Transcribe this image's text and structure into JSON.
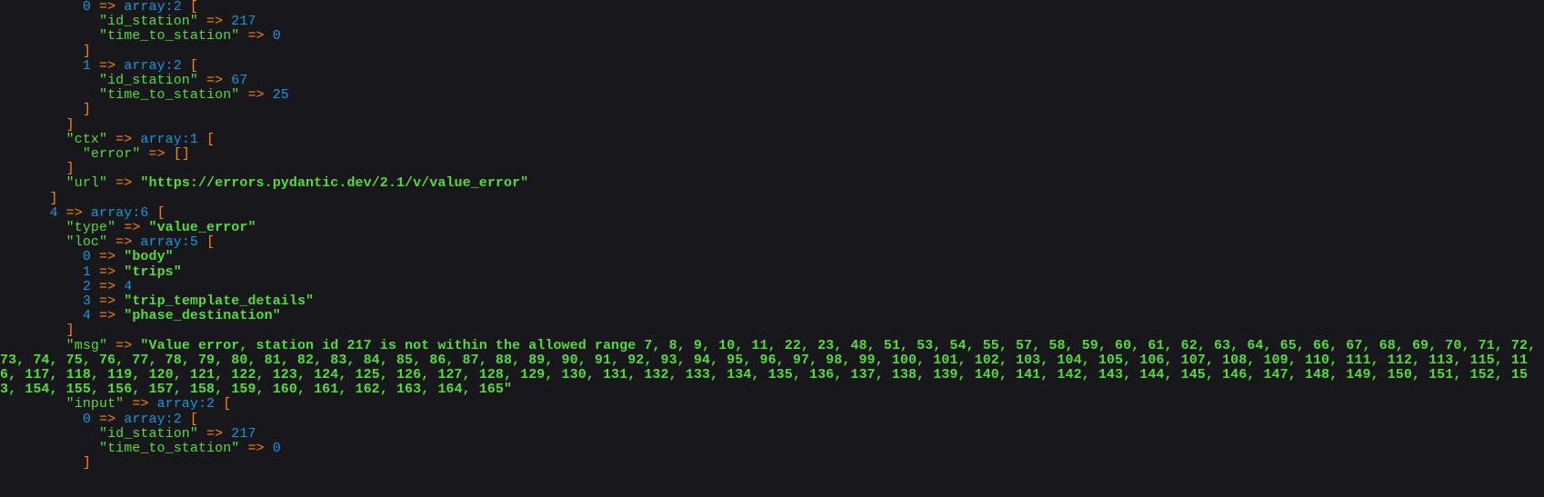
{
  "colors": {
    "background": "#18171B",
    "key": "#56DB3A",
    "string": "#56DB3A",
    "number": "#1299DA",
    "note": "#1299DA",
    "arrow": "#FF8400",
    "bracket": "#FF8400"
  },
  "lines": [
    {
      "indent": 10,
      "parts": [
        {
          "t": "0",
          "c": "i"
        },
        {
          "t": " => ",
          "c": "a"
        },
        {
          "t": "array:2",
          "c": "note"
        },
        {
          "t": " [",
          "c": "b"
        }
      ]
    },
    {
      "indent": 12,
      "parts": [
        {
          "t": "\"id_station\"",
          "c": "k"
        },
        {
          "t": " => ",
          "c": "a"
        },
        {
          "t": "217",
          "c": "n"
        }
      ]
    },
    {
      "indent": 12,
      "parts": [
        {
          "t": "\"time_to_station\"",
          "c": "k"
        },
        {
          "t": " => ",
          "c": "a"
        },
        {
          "t": "0",
          "c": "n"
        }
      ]
    },
    {
      "indent": 10,
      "parts": [
        {
          "t": "]",
          "c": "b"
        }
      ]
    },
    {
      "indent": 10,
      "parts": [
        {
          "t": "1",
          "c": "i"
        },
        {
          "t": " => ",
          "c": "a"
        },
        {
          "t": "array:2",
          "c": "note"
        },
        {
          "t": " [",
          "c": "b"
        }
      ]
    },
    {
      "indent": 12,
      "parts": [
        {
          "t": "\"id_station\"",
          "c": "k"
        },
        {
          "t": " => ",
          "c": "a"
        },
        {
          "t": "67",
          "c": "n"
        }
      ]
    },
    {
      "indent": 12,
      "parts": [
        {
          "t": "\"time_to_station\"",
          "c": "k"
        },
        {
          "t": " => ",
          "c": "a"
        },
        {
          "t": "25",
          "c": "n"
        }
      ]
    },
    {
      "indent": 10,
      "parts": [
        {
          "t": "]",
          "c": "b"
        }
      ]
    },
    {
      "indent": 8,
      "parts": [
        {
          "t": "]",
          "c": "b"
        }
      ]
    },
    {
      "indent": 8,
      "parts": [
        {
          "t": "\"ctx\"",
          "c": "k"
        },
        {
          "t": " => ",
          "c": "a"
        },
        {
          "t": "array:1",
          "c": "note"
        },
        {
          "t": " [",
          "c": "b"
        }
      ]
    },
    {
      "indent": 10,
      "parts": [
        {
          "t": "\"error\"",
          "c": "k"
        },
        {
          "t": " => ",
          "c": "a"
        },
        {
          "t": "[]",
          "c": "b"
        }
      ]
    },
    {
      "indent": 8,
      "parts": [
        {
          "t": "]",
          "c": "b"
        }
      ]
    },
    {
      "indent": 8,
      "parts": [
        {
          "t": "\"url\"",
          "c": "k"
        },
        {
          "t": " => ",
          "c": "a"
        },
        {
          "t": "\"https://errors.pydantic.dev/2.1/v/value_error\"",
          "c": "s"
        }
      ]
    },
    {
      "indent": 6,
      "parts": [
        {
          "t": "]",
          "c": "b"
        }
      ]
    },
    {
      "indent": 6,
      "parts": [
        {
          "t": "4",
          "c": "i"
        },
        {
          "t": " => ",
          "c": "a"
        },
        {
          "t": "array:6",
          "c": "note"
        },
        {
          "t": " [",
          "c": "b"
        }
      ]
    },
    {
      "indent": 8,
      "parts": [
        {
          "t": "\"type\"",
          "c": "k"
        },
        {
          "t": " => ",
          "c": "a"
        },
        {
          "t": "\"value_error\"",
          "c": "s"
        }
      ]
    },
    {
      "indent": 8,
      "parts": [
        {
          "t": "\"loc\"",
          "c": "k"
        },
        {
          "t": " => ",
          "c": "a"
        },
        {
          "t": "array:5",
          "c": "note"
        },
        {
          "t": " [",
          "c": "b"
        }
      ]
    },
    {
      "indent": 10,
      "parts": [
        {
          "t": "0",
          "c": "i"
        },
        {
          "t": " => ",
          "c": "a"
        },
        {
          "t": "\"body\"",
          "c": "s"
        }
      ]
    },
    {
      "indent": 10,
      "parts": [
        {
          "t": "1",
          "c": "i"
        },
        {
          "t": " => ",
          "c": "a"
        },
        {
          "t": "\"trips\"",
          "c": "s"
        }
      ]
    },
    {
      "indent": 10,
      "parts": [
        {
          "t": "2",
          "c": "i"
        },
        {
          "t": " => ",
          "c": "a"
        },
        {
          "t": "4",
          "c": "n"
        }
      ]
    },
    {
      "indent": 10,
      "parts": [
        {
          "t": "3",
          "c": "i"
        },
        {
          "t": " => ",
          "c": "a"
        },
        {
          "t": "\"trip_template_details\"",
          "c": "s"
        }
      ]
    },
    {
      "indent": 10,
      "parts": [
        {
          "t": "4",
          "c": "i"
        },
        {
          "t": " => ",
          "c": "a"
        },
        {
          "t": "\"phase_destination\"",
          "c": "s"
        }
      ]
    },
    {
      "indent": 8,
      "parts": [
        {
          "t": "]",
          "c": "b"
        }
      ]
    },
    {
      "indent": 8,
      "parts": [
        {
          "t": "\"msg\"",
          "c": "k"
        },
        {
          "t": " => ",
          "c": "a"
        },
        {
          "t": "\"Value error, station id 217 is not within the allowed range 7, 8, 9, 10, 11, 22, 23, 48, 51, 53, 54, 55, 57, 58, 59, 60, 61, 62, 63, 64, 65, 66, 67, 68, 69, 70, 71, 72, 73, 74, 75, 76, 77, 78, 79, 80, 81, 82, 83, 84, 85, 86, 87, 88, 89, 90, 91, 92, 93, 94, 95, 96, 97, 98, 99, 100, 101, 102, 103, 104, 105, 106, 107, 108, 109, 110, 111, 112, 113, 115, 116, 117, 118, 119, 120, 121, 122, 123, 124, 125, 126, 127, 128, 129, 130, 131, 132, 133, 134, 135, 136, 137, 138, 139, 140, 141, 142, 143, 144, 145, 146, 147, 148, 149, 150, 151, 152, 153, 154, 155, 156, 157, 158, 159, 160, 161, 162, 163, 164, 165\"",
          "c": "s"
        }
      ]
    },
    {
      "indent": 8,
      "parts": [
        {
          "t": "\"input\"",
          "c": "k"
        },
        {
          "t": " => ",
          "c": "a"
        },
        {
          "t": "array:2",
          "c": "note"
        },
        {
          "t": " [",
          "c": "b"
        }
      ]
    },
    {
      "indent": 10,
      "parts": [
        {
          "t": "0",
          "c": "i"
        },
        {
          "t": " => ",
          "c": "a"
        },
        {
          "t": "array:2",
          "c": "note"
        },
        {
          "t": " [",
          "c": "b"
        }
      ]
    },
    {
      "indent": 12,
      "parts": [
        {
          "t": "\"id_station\"",
          "c": "k"
        },
        {
          "t": " => ",
          "c": "a"
        },
        {
          "t": "217",
          "c": "n"
        }
      ]
    },
    {
      "indent": 12,
      "parts": [
        {
          "t": "\"time_to_station\"",
          "c": "k"
        },
        {
          "t": " => ",
          "c": "a"
        },
        {
          "t": "0",
          "c": "n"
        }
      ]
    },
    {
      "indent": 10,
      "parts": [
        {
          "t": "]",
          "c": "b"
        }
      ]
    }
  ]
}
